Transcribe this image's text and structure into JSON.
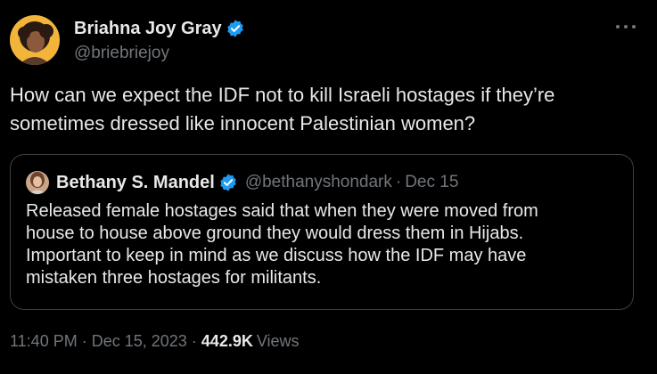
{
  "author": {
    "display_name": "Briahna Joy Gray",
    "handle": "@briebriejoy",
    "verified": true,
    "avatar_icon": "profile-photo"
  },
  "tweet": {
    "text": "How can we expect the IDF not to kill Israeli hostages if they’re\nsometimes dressed like innocent Palestinian women?"
  },
  "quoted": {
    "display_name": "Bethany S. Mandel",
    "handle": "@bethanyshondark",
    "separator": "·",
    "date": "Dec 15",
    "verified": true,
    "text": "Released female hostages said that when they were moved from\nhouse to house above ground they would dress them in Hijabs.\nImportant to keep in mind as we discuss how the IDF may have\nmistaken three hostages for militants."
  },
  "meta": {
    "time": "11:40 PM",
    "separator": "·",
    "date": "Dec 15, 2023",
    "separator2": "·",
    "views_count": "442.9K",
    "views_label": "Views"
  },
  "colors": {
    "background": "#000000",
    "text": "#e7e9ea",
    "muted": "#71767b",
    "verified_blue": "#1d9bf0",
    "border": "#3c4043"
  }
}
